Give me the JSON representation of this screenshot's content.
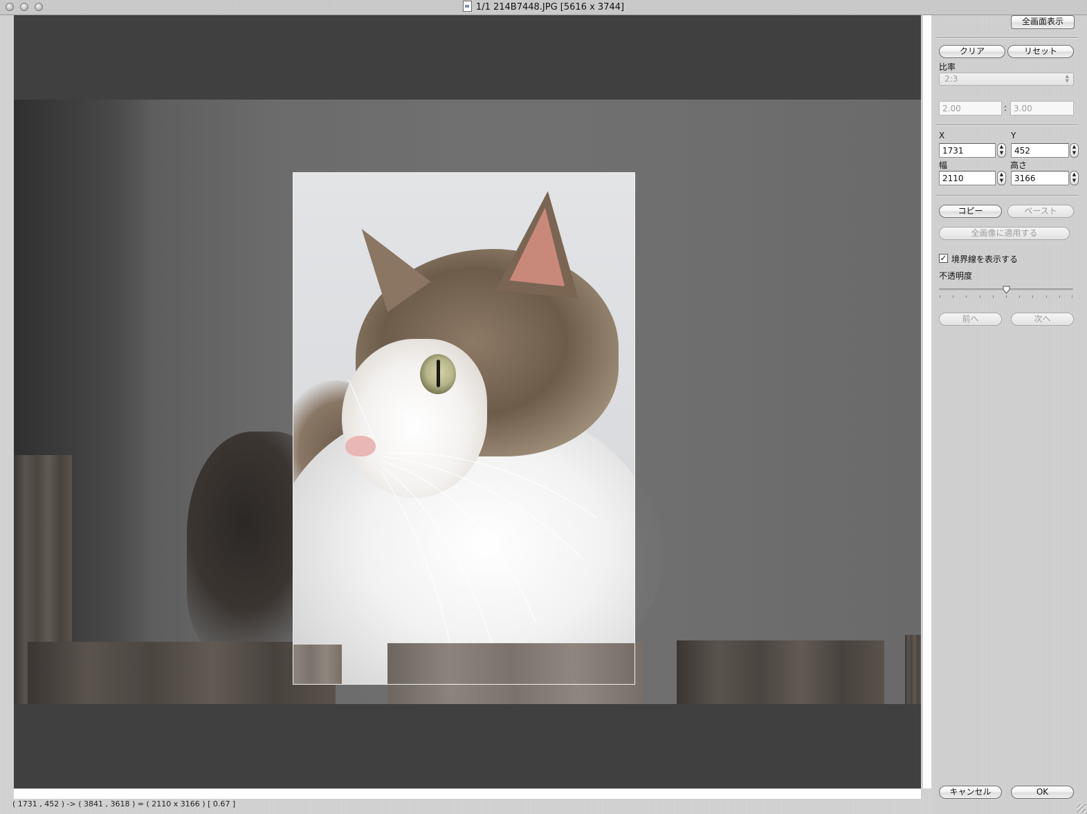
{
  "window": {
    "title": "1/1 214B7448.JPG [5616 x 3744]"
  },
  "status_bar": {
    "text": "( 1731 , 452 ) -> ( 3841 , 3618 ) = ( 2110 x 3166 ) [ 0.67 ]"
  },
  "panel": {
    "fullscreen_label": "全画面表示",
    "clear_label": "クリア",
    "reset_label": "リセット",
    "ratio_label": "比率",
    "ratio_select_value": "2:3",
    "ratio_width": "2.00",
    "ratio_separator": ":",
    "ratio_height": "3.00",
    "x_label": "X",
    "y_label": "Y",
    "x_value": "1731",
    "y_value": "452",
    "width_label": "幅",
    "height_label": "高さ",
    "width_value": "2110",
    "height_value": "3166",
    "copy_label": "コピー",
    "paste_label": "ペースト",
    "apply_all_label": "全画像に適用する",
    "show_border_label": "境界線を表示する",
    "show_border_checked": true,
    "opacity_label": "不透明度",
    "opacity_level": 0.5,
    "prev_label": "前へ",
    "next_label": "次へ",
    "cancel_label": "キャンセル",
    "ok_label": "OK"
  },
  "icons": {
    "document": "document-icon",
    "checkmark": "check-icon",
    "stepper": "stepper-arrows-icon",
    "slider_thumb": "slider-thumb-icon",
    "resize": "resize-grip-icon"
  },
  "colors": {
    "viewer_background": "#404040",
    "panel_metal": "#d0d0d0"
  }
}
